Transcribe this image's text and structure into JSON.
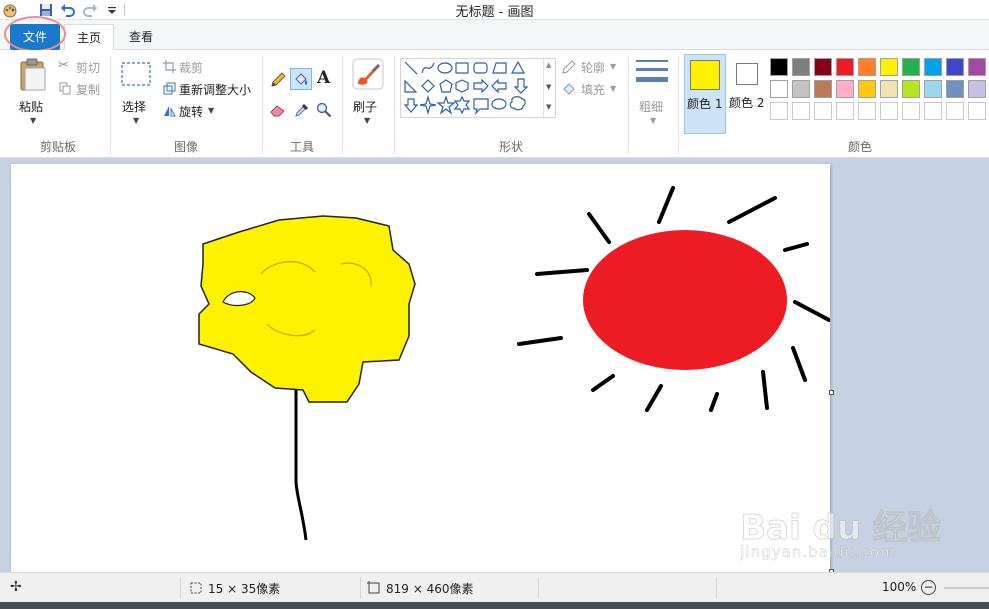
{
  "window": {
    "title": "无标题 - 画图"
  },
  "tabs": [
    {
      "label": "文件"
    },
    {
      "label": "主页"
    },
    {
      "label": "查看"
    }
  ],
  "ribbon": {
    "clipboard": {
      "group_label": "剪贴板",
      "paste": "粘贴",
      "cut": "剪切",
      "copy": "复制"
    },
    "image": {
      "group_label": "图像",
      "select": "选择",
      "crop": "裁剪",
      "resize": "重新调整大小",
      "rotate": "旋转"
    },
    "tools": {
      "group_label": "工具"
    },
    "brushes": {
      "label": "刷子"
    },
    "shapes": {
      "group_label": "形状",
      "outline": "轮廓",
      "fill": "填充"
    },
    "size": {
      "label": "粗细"
    },
    "colors": {
      "group_label": "颜色",
      "color1_label": "颜色 1",
      "color2_label": "颜色 2",
      "color1": "#fff200",
      "color2": "#ffffff",
      "palette_row1": [
        "#000000",
        "#7f7f7f",
        "#880015",
        "#ed1c24",
        "#ff7f27",
        "#fff200",
        "#22b14c",
        "#00a2e8",
        "#3f48cc",
        "#a349a4"
      ],
      "palette_row2": [
        "#ffffff",
        "#c3c3c3",
        "#b97a57",
        "#ffaec9",
        "#ffc90e",
        "#efe4b0",
        "#b5e61d",
        "#99d9ea",
        "#7092be",
        "#c8bfe7"
      ]
    }
  },
  "statusbar": {
    "selection_size": "15 × 35像素",
    "canvas_size": "819 × 460像素",
    "zoom": "100%"
  },
  "watermark": {
    "brand": "Bai du 经验",
    "url": "jingyan.baidu.com"
  }
}
